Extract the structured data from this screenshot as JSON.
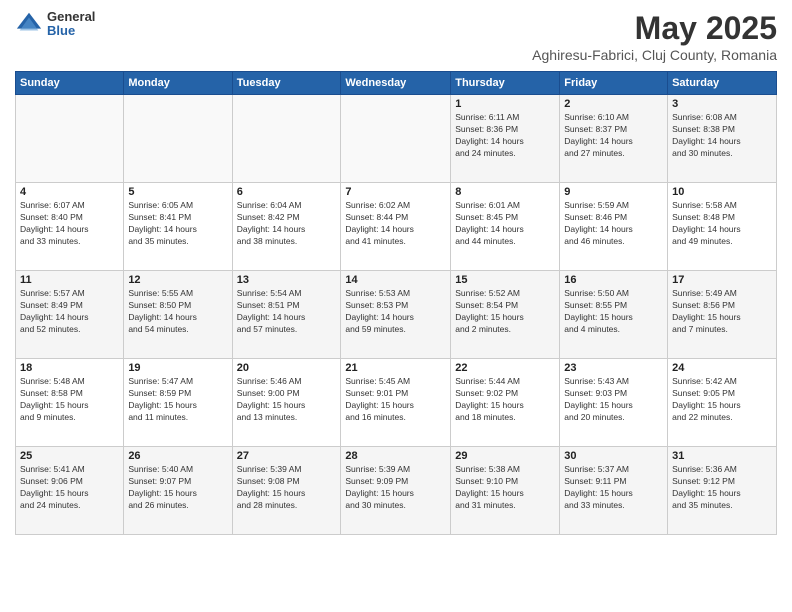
{
  "logo": {
    "general": "General",
    "blue": "Blue"
  },
  "title": "May 2025",
  "subtitle": "Aghiresu-Fabrici, Cluj County, Romania",
  "headers": [
    "Sunday",
    "Monday",
    "Tuesday",
    "Wednesday",
    "Thursday",
    "Friday",
    "Saturday"
  ],
  "weeks": [
    [
      {
        "day": "",
        "info": ""
      },
      {
        "day": "",
        "info": ""
      },
      {
        "day": "",
        "info": ""
      },
      {
        "day": "",
        "info": ""
      },
      {
        "day": "1",
        "info": "Sunrise: 6:11 AM\nSunset: 8:36 PM\nDaylight: 14 hours\nand 24 minutes."
      },
      {
        "day": "2",
        "info": "Sunrise: 6:10 AM\nSunset: 8:37 PM\nDaylight: 14 hours\nand 27 minutes."
      },
      {
        "day": "3",
        "info": "Sunrise: 6:08 AM\nSunset: 8:38 PM\nDaylight: 14 hours\nand 30 minutes."
      }
    ],
    [
      {
        "day": "4",
        "info": "Sunrise: 6:07 AM\nSunset: 8:40 PM\nDaylight: 14 hours\nand 33 minutes."
      },
      {
        "day": "5",
        "info": "Sunrise: 6:05 AM\nSunset: 8:41 PM\nDaylight: 14 hours\nand 35 minutes."
      },
      {
        "day": "6",
        "info": "Sunrise: 6:04 AM\nSunset: 8:42 PM\nDaylight: 14 hours\nand 38 minutes."
      },
      {
        "day": "7",
        "info": "Sunrise: 6:02 AM\nSunset: 8:44 PM\nDaylight: 14 hours\nand 41 minutes."
      },
      {
        "day": "8",
        "info": "Sunrise: 6:01 AM\nSunset: 8:45 PM\nDaylight: 14 hours\nand 44 minutes."
      },
      {
        "day": "9",
        "info": "Sunrise: 5:59 AM\nSunset: 8:46 PM\nDaylight: 14 hours\nand 46 minutes."
      },
      {
        "day": "10",
        "info": "Sunrise: 5:58 AM\nSunset: 8:48 PM\nDaylight: 14 hours\nand 49 minutes."
      }
    ],
    [
      {
        "day": "11",
        "info": "Sunrise: 5:57 AM\nSunset: 8:49 PM\nDaylight: 14 hours\nand 52 minutes."
      },
      {
        "day": "12",
        "info": "Sunrise: 5:55 AM\nSunset: 8:50 PM\nDaylight: 14 hours\nand 54 minutes."
      },
      {
        "day": "13",
        "info": "Sunrise: 5:54 AM\nSunset: 8:51 PM\nDaylight: 14 hours\nand 57 minutes."
      },
      {
        "day": "14",
        "info": "Sunrise: 5:53 AM\nSunset: 8:53 PM\nDaylight: 14 hours\nand 59 minutes."
      },
      {
        "day": "15",
        "info": "Sunrise: 5:52 AM\nSunset: 8:54 PM\nDaylight: 15 hours\nand 2 minutes."
      },
      {
        "day": "16",
        "info": "Sunrise: 5:50 AM\nSunset: 8:55 PM\nDaylight: 15 hours\nand 4 minutes."
      },
      {
        "day": "17",
        "info": "Sunrise: 5:49 AM\nSunset: 8:56 PM\nDaylight: 15 hours\nand 7 minutes."
      }
    ],
    [
      {
        "day": "18",
        "info": "Sunrise: 5:48 AM\nSunset: 8:58 PM\nDaylight: 15 hours\nand 9 minutes."
      },
      {
        "day": "19",
        "info": "Sunrise: 5:47 AM\nSunset: 8:59 PM\nDaylight: 15 hours\nand 11 minutes."
      },
      {
        "day": "20",
        "info": "Sunrise: 5:46 AM\nSunset: 9:00 PM\nDaylight: 15 hours\nand 13 minutes."
      },
      {
        "day": "21",
        "info": "Sunrise: 5:45 AM\nSunset: 9:01 PM\nDaylight: 15 hours\nand 16 minutes."
      },
      {
        "day": "22",
        "info": "Sunrise: 5:44 AM\nSunset: 9:02 PM\nDaylight: 15 hours\nand 18 minutes."
      },
      {
        "day": "23",
        "info": "Sunrise: 5:43 AM\nSunset: 9:03 PM\nDaylight: 15 hours\nand 20 minutes."
      },
      {
        "day": "24",
        "info": "Sunrise: 5:42 AM\nSunset: 9:05 PM\nDaylight: 15 hours\nand 22 minutes."
      }
    ],
    [
      {
        "day": "25",
        "info": "Sunrise: 5:41 AM\nSunset: 9:06 PM\nDaylight: 15 hours\nand 24 minutes."
      },
      {
        "day": "26",
        "info": "Sunrise: 5:40 AM\nSunset: 9:07 PM\nDaylight: 15 hours\nand 26 minutes."
      },
      {
        "day": "27",
        "info": "Sunrise: 5:39 AM\nSunset: 9:08 PM\nDaylight: 15 hours\nand 28 minutes."
      },
      {
        "day": "28",
        "info": "Sunrise: 5:39 AM\nSunset: 9:09 PM\nDaylight: 15 hours\nand 30 minutes."
      },
      {
        "day": "29",
        "info": "Sunrise: 5:38 AM\nSunset: 9:10 PM\nDaylight: 15 hours\nand 31 minutes."
      },
      {
        "day": "30",
        "info": "Sunrise: 5:37 AM\nSunset: 9:11 PM\nDaylight: 15 hours\nand 33 minutes."
      },
      {
        "day": "31",
        "info": "Sunrise: 5:36 AM\nSunset: 9:12 PM\nDaylight: 15 hours\nand 35 minutes."
      }
    ]
  ]
}
